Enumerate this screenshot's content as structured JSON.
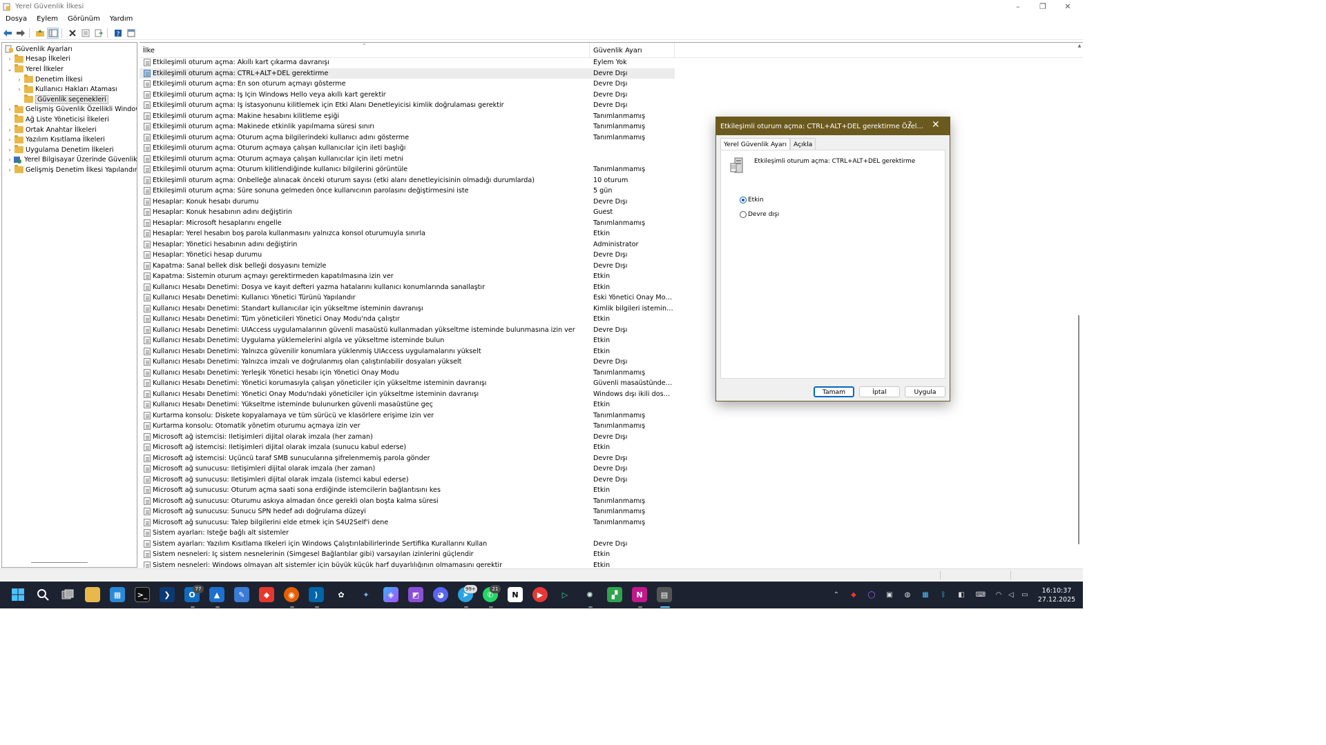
{
  "window": {
    "title": "Yerel Güvenlik İlkesi",
    "controls": [
      "–",
      "❐",
      "✕"
    ]
  },
  "menu": [
    "Dosya",
    "Eylem",
    "Görünüm",
    "Yardım"
  ],
  "tree": [
    {
      "label": "Güvenlik Ayarları",
      "expander": "",
      "icon": "security-settings-icon",
      "level": 0
    },
    {
      "label": "Hesap İlkeleri",
      "expander": "›",
      "icon": "folder-icon",
      "level": 1
    },
    {
      "label": "Yerel İlkeler",
      "expander": "⌄",
      "icon": "folder-icon",
      "level": 1
    },
    {
      "label": "Denetim İlkesi",
      "expander": "›",
      "icon": "folder-icon",
      "level": 2
    },
    {
      "label": "Kullanıcı Hakları Ataması",
      "expander": "›",
      "icon": "folder-icon",
      "level": 2
    },
    {
      "label": "Güvenlik seçenekleri",
      "expander": "",
      "icon": "folder-icon",
      "level": 2,
      "selected": true
    },
    {
      "label": "Gelişmiş Güvenlik Özellikli Windows D",
      "expander": "›",
      "icon": "folder-icon",
      "level": 1
    },
    {
      "label": "Ağ Liste Yöneticisi İlkeleri",
      "expander": "",
      "icon": "folder-icon",
      "level": 1
    },
    {
      "label": "Ortak Anahtar İlkeleri",
      "expander": "›",
      "icon": "folder-icon",
      "level": 1
    },
    {
      "label": "Yazılım Kısıtlama İlkeleri",
      "expander": "›",
      "icon": "folder-icon",
      "level": 1
    },
    {
      "label": "Uygulama Denetim İlkeleri",
      "expander": "›",
      "icon": "folder-icon",
      "level": 1
    },
    {
      "label": "Yerel Bilgisayar Üzerinde Güvenlik İlke",
      "expander": "›",
      "icon": "ip-security-icon",
      "level": 1
    },
    {
      "label": "Gelişmiş Denetim İlkesi Yapılandırmas",
      "expander": "›",
      "icon": "folder-icon",
      "level": 1
    }
  ],
  "list": {
    "columns": [
      "İlke",
      "Güvenlik Ayarı"
    ],
    "rows": [
      {
        "policy": "Etkileşimli oturum açma: Akıllı kart çıkarma davranışı",
        "setting": "Eylem Yok"
      },
      {
        "policy": "Etkileşimli oturum açma: CTRL+ALT+DEL gerektirme",
        "setting": "Devre Dışı",
        "selected": true
      },
      {
        "policy": "Etkileşimli oturum açma: En son oturum açmayı gösterme",
        "setting": "Devre Dışı"
      },
      {
        "policy": "Etkileşimli oturum açma: İş İçin Windows Hello veya akıllı kart gerektir",
        "setting": "Devre Dışı"
      },
      {
        "policy": "Etkileşimli oturum açma: İş istasyonunu kilitlemek için Etki Alanı Denetleyicisi kimlik doğrulaması gerektir",
        "setting": "Devre Dışı"
      },
      {
        "policy": "Etkileşimli oturum açma: Makine hesabını kilitleme eşiği",
        "setting": "Tanımlanmamış"
      },
      {
        "policy": "Etkileşimli oturum açma: Makinede etkinlik yapılmama süresi sınırı",
        "setting": "Tanımlanmamış"
      },
      {
        "policy": "Etkileşimli oturum açma: Oturum açma bilgilerindeki kullanıcı adını gösterme",
        "setting": "Tanımlanmamış"
      },
      {
        "policy": "Etkileşimli oturum açma: Oturum açmaya çalışan kullanıcılar için ileti başlığı",
        "setting": ""
      },
      {
        "policy": "Etkileşimli oturum açma: Oturum açmaya çalışan kullanıcılar için ileti metni",
        "setting": ""
      },
      {
        "policy": "Etkileşimli oturum açma: Oturum kilitlendiğinde kullanıcı bilgilerini görüntüle",
        "setting": "Tanımlanmamış"
      },
      {
        "policy": "Etkileşimli oturum açma: Önbelleğe alınacak önceki oturum sayısı (etki alanı denetleyicisinin olmadığı durumlarda)",
        "setting": "10 oturum"
      },
      {
        "policy": "Etkileşimli oturum açma: Süre sonuna gelmeden önce kullanıcının parolasını değiştirmesini iste",
        "setting": "5 gün"
      },
      {
        "policy": "Hesaplar: Konuk hesabı durumu",
        "setting": "Devre Dışı"
      },
      {
        "policy": "Hesaplar: Konuk hesabının adını değiştirin",
        "setting": "Guest"
      },
      {
        "policy": "Hesaplar: Microsoft hesaplarını engelle",
        "setting": "Tanımlanmamış"
      },
      {
        "policy": "Hesaplar: Yerel hesabın boş parola kullanmasını yalnızca konsol oturumuyla sınırla",
        "setting": "Etkin"
      },
      {
        "policy": "Hesaplar: Yönetici hesabının adını değiştirin",
        "setting": "Administrator"
      },
      {
        "policy": "Hesaplar: Yönetici hesap durumu",
        "setting": "Devre Dışı"
      },
      {
        "policy": "Kapatma: Sanal bellek disk belleği dosyasını temizle",
        "setting": "Devre Dışı"
      },
      {
        "policy": "Kapatma: Sistemin oturum açmayı gerektirmeden kapatılmasına izin ver",
        "setting": "Etkin"
      },
      {
        "policy": "Kullanıcı Hesabı Denetimi: Dosya ve kayıt defteri yazma hatalarını kullanıcı konumlarında sanallaştır",
        "setting": "Etkin"
      },
      {
        "policy": "Kullanıcı Hesabı Denetimi: Kullanıcı Yönetici Türünü Yapılandır",
        "setting": "Eski Yönetici Onay Mod..."
      },
      {
        "policy": "Kullanıcı Hesabı Denetimi: Standart kullanıcılar için yükseltme isteminin davranışı",
        "setting": "Kimlik bilgileri istemind..."
      },
      {
        "policy": "Kullanıcı Hesabı Denetimi: Tüm yöneticileri Yönetici Onay Modu'nda çalıştır",
        "setting": "Etkin"
      },
      {
        "policy": "Kullanıcı Hesabı Denetimi: UIAccess uygulamalarının güvenli masaüstü kullanmadan yükseltme isteminde bulunmasına izin ver",
        "setting": "Devre Dışı"
      },
      {
        "policy": "Kullanıcı Hesabı Denetimi: Uygulama yüklemelerini algıla ve yükseltme isteminde bulun",
        "setting": "Etkin"
      },
      {
        "policy": "Kullanıcı Hesabı Denetimi: Yalnızca güvenilir konumlara yüklenmiş UIAccess uygulamalarını yükselt",
        "setting": "Etkin"
      },
      {
        "policy": "Kullanıcı Hesabı Denetimi: Yalnızca imzalı ve doğrulanmış olan çalıştırılabilir dosyaları yükselt",
        "setting": "Devre Dışı"
      },
      {
        "policy": "Kullanıcı Hesabı Denetimi: Yerleşik Yönetici hesabı için Yönetici Onay Modu",
        "setting": "Tanımlanmamış"
      },
      {
        "policy": "Kullanıcı Hesabı Denetimi: Yönetici korumasıyla çalışan yöneticiler için yükseltme isteminin davranışı",
        "setting": "Güvenli masaüstünde ki..."
      },
      {
        "policy": "Kullanıcı Hesabı Denetimi: Yönetici Onay Modu'ndaki yöneticiler için yükseltme isteminin davranışı",
        "setting": "Windows dışı ikili dosyal..."
      },
      {
        "policy": "Kullanıcı Hesabı Denetimi: Yükseltme isteminde bulunurken güvenli masaüstüne geç",
        "setting": "Etkin"
      },
      {
        "policy": "Kurtarma konsolu: Diskete kopyalamaya ve tüm sürücü ve klasörlere erişime izin ver",
        "setting": "Tanımlanmamış"
      },
      {
        "policy": "Kurtarma konsolu: Otomatik yönetim oturumu açmaya izin ver",
        "setting": "Tanımlanmamış"
      },
      {
        "policy": "Microsoft ağ istemcisi: İletişimleri dijital olarak imzala (her zaman)",
        "setting": "Devre Dışı"
      },
      {
        "policy": "Microsoft ağ istemcisi: İletişimleri dijital olarak imzala (sunucu kabul ederse)",
        "setting": "Etkin"
      },
      {
        "policy": "Microsoft ağ istemcisi: Üçüncü taraf SMB sunucularına şifrelenmemiş parola gönder",
        "setting": "Devre Dışı"
      },
      {
        "policy": "Microsoft ağ sunucusu: İletişimleri dijital olarak imzala (her zaman)",
        "setting": "Devre Dışı"
      },
      {
        "policy": "Microsoft ağ sunucusu: İletişimleri dijital olarak imzala (istemci kabul ederse)",
        "setting": "Devre Dışı"
      },
      {
        "policy": "Microsoft ağ sunucusu: Oturum açma saati sona erdiğinde istemcilerin bağlantısını kes",
        "setting": "Etkin"
      },
      {
        "policy": "Microsoft ağ sunucusu: Oturumu askıya almadan önce gerekli olan boşta kalma süresi",
        "setting": "Tanımlanmamış"
      },
      {
        "policy": "Microsoft ağ sunucusu: Sunucu SPN hedef adı doğrulama düzeyi",
        "setting": "Tanımlanmamış"
      },
      {
        "policy": "Microsoft ağ sunucusu: Talep bilgilerini elde etmek için S4U2Self'i dene",
        "setting": "Tanımlanmamış"
      },
      {
        "policy": "Sistem ayarları: İsteğe bağlı alt sistemler",
        "setting": ""
      },
      {
        "policy": "Sistem ayarları: Yazılım Kısıtlama İlkeleri için Windows Çalıştırılabilirlerinde Sertifika Kurallarını Kullan",
        "setting": "Devre Dışı"
      },
      {
        "policy": "Sistem nesneleri: İç sistem nesnelerinin (Simgesel Bağlantılar gibi) varsayılan izinlerini güçlendir",
        "setting": "Etkin"
      },
      {
        "policy": "Sistem nesneleri: Windows olmayan alt sistemler için büyük küçük harf duyarlılığının olmamasını gerektir",
        "setting": "Etkin"
      }
    ]
  },
  "dialog": {
    "title": "Etkileşimli oturum açma: CTRL+ALT+DEL gerektirme Özel...",
    "help": "?",
    "close": "✕",
    "tabs": [
      "Yerel Güvenlik Ayarı",
      "Açıkla"
    ],
    "policy_name": "Etkileşimli oturum açma: CTRL+ALT+DEL gerektirme",
    "options": [
      {
        "label": "Etkin",
        "checked": true
      },
      {
        "label": "Devre dışı",
        "checked": false
      }
    ],
    "buttons": {
      "ok": "Tamam",
      "cancel": "İptal",
      "apply": "Uygula"
    }
  },
  "taskbar": {
    "badges": {
      "outlook": "77",
      "chat": "99+",
      "whatsapp": "21"
    },
    "time": "16:10:37",
    "date": "27.12.2025"
  },
  "colors": {
    "dialog_title": "#6b5a1e",
    "selection": "#ececec",
    "taskbar": "#1c2230",
    "folder": "#e8b94a"
  }
}
